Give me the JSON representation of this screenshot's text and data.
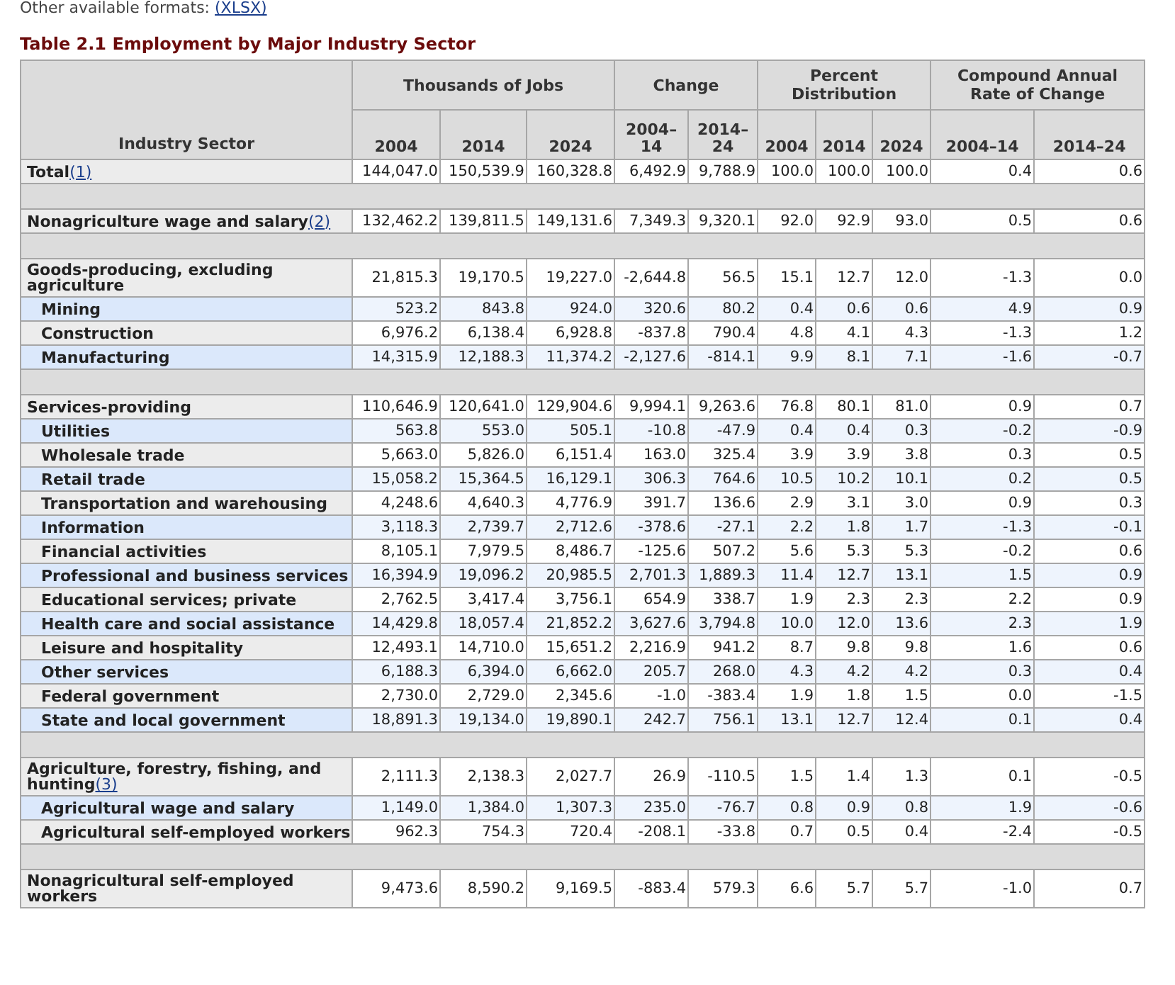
{
  "formats": {
    "label": "Other available formats:",
    "link": "(XLSX)"
  },
  "title": "Table 2.1 Employment by Major Industry Sector",
  "header": {
    "row_header": "Industry Sector",
    "groups": [
      {
        "label": "Thousands of Jobs",
        "columns": [
          "2004",
          "2014",
          "2024"
        ]
      },
      {
        "label": "Change",
        "columns": [
          "2004–14",
          "2014–24"
        ]
      },
      {
        "label": "Percent Distribution",
        "columns": [
          "2004",
          "2014",
          "2024"
        ]
      },
      {
        "label": "Compound Annual Rate of Change",
        "columns": [
          "2004–14",
          "2014–24"
        ]
      }
    ]
  },
  "rows": [
    {
      "kind": "main",
      "label": "Total",
      "note": "(1)",
      "values": [
        "144,047.0",
        "150,539.9",
        "160,328.8",
        "6,492.9",
        "9,788.9",
        "100.0",
        "100.0",
        "100.0",
        "0.4",
        "0.6"
      ]
    },
    {
      "kind": "spacer"
    },
    {
      "kind": "main",
      "label": "Nonagriculture wage and salary",
      "note": "(2)",
      "values": [
        "132,462.2",
        "139,811.5",
        "149,131.6",
        "7,349.3",
        "9,320.1",
        "92.0",
        "92.9",
        "93.0",
        "0.5",
        "0.6"
      ]
    },
    {
      "kind": "spacer"
    },
    {
      "kind": "main",
      "label": "Goods-producing, excluding agriculture",
      "values": [
        "21,815.3",
        "19,170.5",
        "19,227.0",
        "-2,644.8",
        "56.5",
        "15.1",
        "12.7",
        "12.0",
        "-1.3",
        "0.0"
      ]
    },
    {
      "kind": "sub",
      "label": "Mining",
      "values": [
        "523.2",
        "843.8",
        "924.0",
        "320.6",
        "80.2",
        "0.4",
        "0.6",
        "0.6",
        "4.9",
        "0.9"
      ]
    },
    {
      "kind": "sub",
      "label": "Construction",
      "values": [
        "6,976.2",
        "6,138.4",
        "6,928.8",
        "-837.8",
        "790.4",
        "4.8",
        "4.1",
        "4.3",
        "-1.3",
        "1.2"
      ]
    },
    {
      "kind": "sub",
      "label": "Manufacturing",
      "values": [
        "14,315.9",
        "12,188.3",
        "11,374.2",
        "-2,127.6",
        "-814.1",
        "9.9",
        "8.1",
        "7.1",
        "-1.6",
        "-0.7"
      ]
    },
    {
      "kind": "spacer"
    },
    {
      "kind": "main",
      "label": "Services-providing",
      "values": [
        "110,646.9",
        "120,641.0",
        "129,904.6",
        "9,994.1",
        "9,263.6",
        "76.8",
        "80.1",
        "81.0",
        "0.9",
        "0.7"
      ]
    },
    {
      "kind": "sub",
      "label": "Utilities",
      "values": [
        "563.8",
        "553.0",
        "505.1",
        "-10.8",
        "-47.9",
        "0.4",
        "0.4",
        "0.3",
        "-0.2",
        "-0.9"
      ]
    },
    {
      "kind": "sub",
      "label": "Wholesale trade",
      "values": [
        "5,663.0",
        "5,826.0",
        "6,151.4",
        "163.0",
        "325.4",
        "3.9",
        "3.9",
        "3.8",
        "0.3",
        "0.5"
      ]
    },
    {
      "kind": "sub",
      "label": "Retail trade",
      "values": [
        "15,058.2",
        "15,364.5",
        "16,129.1",
        "306.3",
        "764.6",
        "10.5",
        "10.2",
        "10.1",
        "0.2",
        "0.5"
      ]
    },
    {
      "kind": "sub",
      "label": "Transportation and warehousing",
      "values": [
        "4,248.6",
        "4,640.3",
        "4,776.9",
        "391.7",
        "136.6",
        "2.9",
        "3.1",
        "3.0",
        "0.9",
        "0.3"
      ]
    },
    {
      "kind": "sub",
      "label": "Information",
      "values": [
        "3,118.3",
        "2,739.7",
        "2,712.6",
        "-378.6",
        "-27.1",
        "2.2",
        "1.8",
        "1.7",
        "-1.3",
        "-0.1"
      ]
    },
    {
      "kind": "sub",
      "label": "Financial activities",
      "values": [
        "8,105.1",
        "7,979.5",
        "8,486.7",
        "-125.6",
        "507.2",
        "5.6",
        "5.3",
        "5.3",
        "-0.2",
        "0.6"
      ]
    },
    {
      "kind": "sub",
      "label": "Professional and business services",
      "values": [
        "16,394.9",
        "19,096.2",
        "20,985.5",
        "2,701.3",
        "1,889.3",
        "11.4",
        "12.7",
        "13.1",
        "1.5",
        "0.9"
      ]
    },
    {
      "kind": "sub",
      "label": "Educational services; private",
      "values": [
        "2,762.5",
        "3,417.4",
        "3,756.1",
        "654.9",
        "338.7",
        "1.9",
        "2.3",
        "2.3",
        "2.2",
        "0.9"
      ]
    },
    {
      "kind": "sub",
      "label": "Health care and social assistance",
      "values": [
        "14,429.8",
        "18,057.4",
        "21,852.2",
        "3,627.6",
        "3,794.8",
        "10.0",
        "12.0",
        "13.6",
        "2.3",
        "1.9"
      ]
    },
    {
      "kind": "sub",
      "label": "Leisure and hospitality",
      "values": [
        "12,493.1",
        "14,710.0",
        "15,651.2",
        "2,216.9",
        "941.2",
        "8.7",
        "9.8",
        "9.8",
        "1.6",
        "0.6"
      ]
    },
    {
      "kind": "sub",
      "label": "Other services",
      "values": [
        "6,188.3",
        "6,394.0",
        "6,662.0",
        "205.7",
        "268.0",
        "4.3",
        "4.2",
        "4.2",
        "0.3",
        "0.4"
      ]
    },
    {
      "kind": "sub",
      "label": "Federal government",
      "values": [
        "2,730.0",
        "2,729.0",
        "2,345.6",
        "-1.0",
        "-383.4",
        "1.9",
        "1.8",
        "1.5",
        "0.0",
        "-1.5"
      ]
    },
    {
      "kind": "sub",
      "label": "State and local government",
      "values": [
        "18,891.3",
        "19,134.0",
        "19,890.1",
        "242.7",
        "756.1",
        "13.1",
        "12.7",
        "12.4",
        "0.1",
        "0.4"
      ]
    },
    {
      "kind": "spacer"
    },
    {
      "kind": "main",
      "label": "Agriculture, forestry, fishing, and hunting",
      "note": "(3)",
      "values": [
        "2,111.3",
        "2,138.3",
        "2,027.7",
        "26.9",
        "-110.5",
        "1.5",
        "1.4",
        "1.3",
        "0.1",
        "-0.5"
      ]
    },
    {
      "kind": "sub",
      "label": "Agricultural wage and salary",
      "values": [
        "1,149.0",
        "1,384.0",
        "1,307.3",
        "235.0",
        "-76.7",
        "0.8",
        "0.9",
        "0.8",
        "1.9",
        "-0.6"
      ]
    },
    {
      "kind": "sub",
      "label": "Agricultural self-employed workers",
      "values": [
        "962.3",
        "754.3",
        "720.4",
        "-208.1",
        "-33.8",
        "0.7",
        "0.5",
        "0.4",
        "-2.4",
        "-0.5"
      ]
    },
    {
      "kind": "spacer"
    },
    {
      "kind": "main",
      "label": "Nonagricultural self-employed workers",
      "values": [
        "9,473.6",
        "8,590.2",
        "9,169.5",
        "-883.4",
        "579.3",
        "6.6",
        "5.7",
        "5.7",
        "-1.0",
        "0.7"
      ]
    }
  ]
}
